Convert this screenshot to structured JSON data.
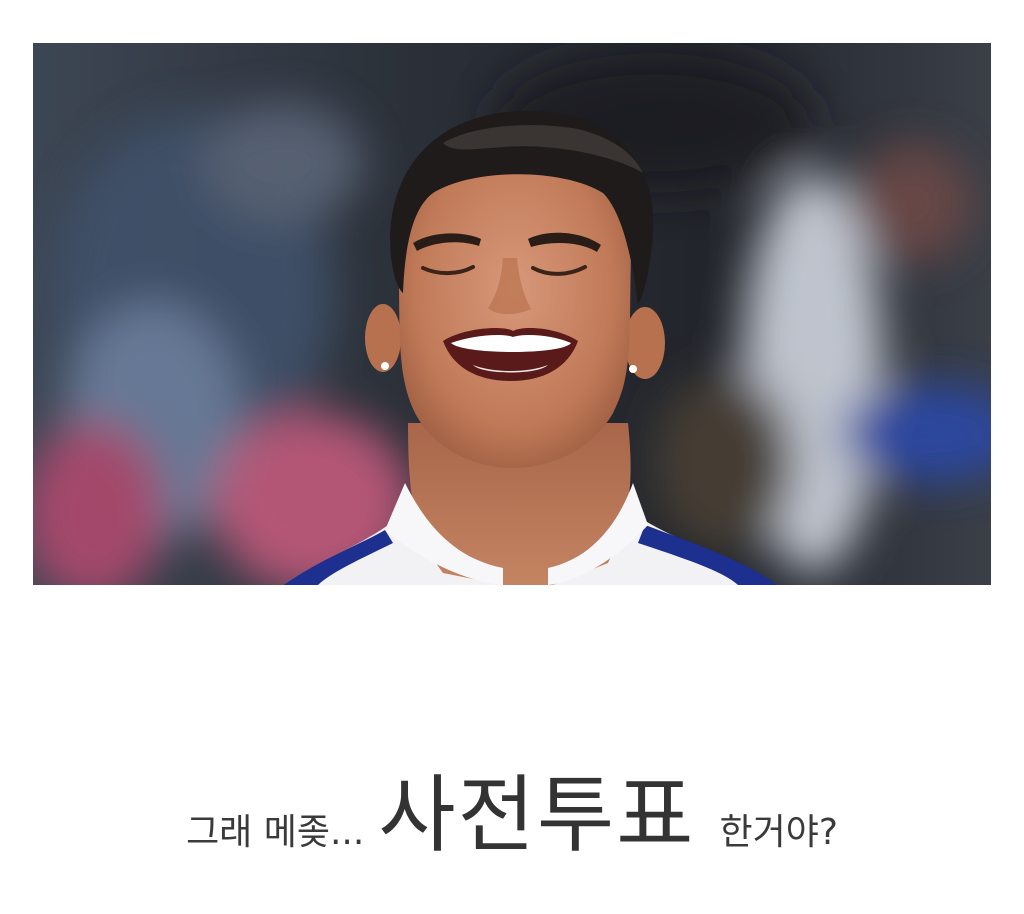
{
  "image": {
    "description_name": "laughing-player-photo",
    "colors": {
      "background": "#2a2d35",
      "skin": "#c98866",
      "shirt": "#f2f2f4",
      "shirt_trim": "#1d2f8f"
    }
  },
  "caption": {
    "prefix": "그래 메좆...",
    "emphasis": "사전투표",
    "suffix": "한거야?"
  }
}
